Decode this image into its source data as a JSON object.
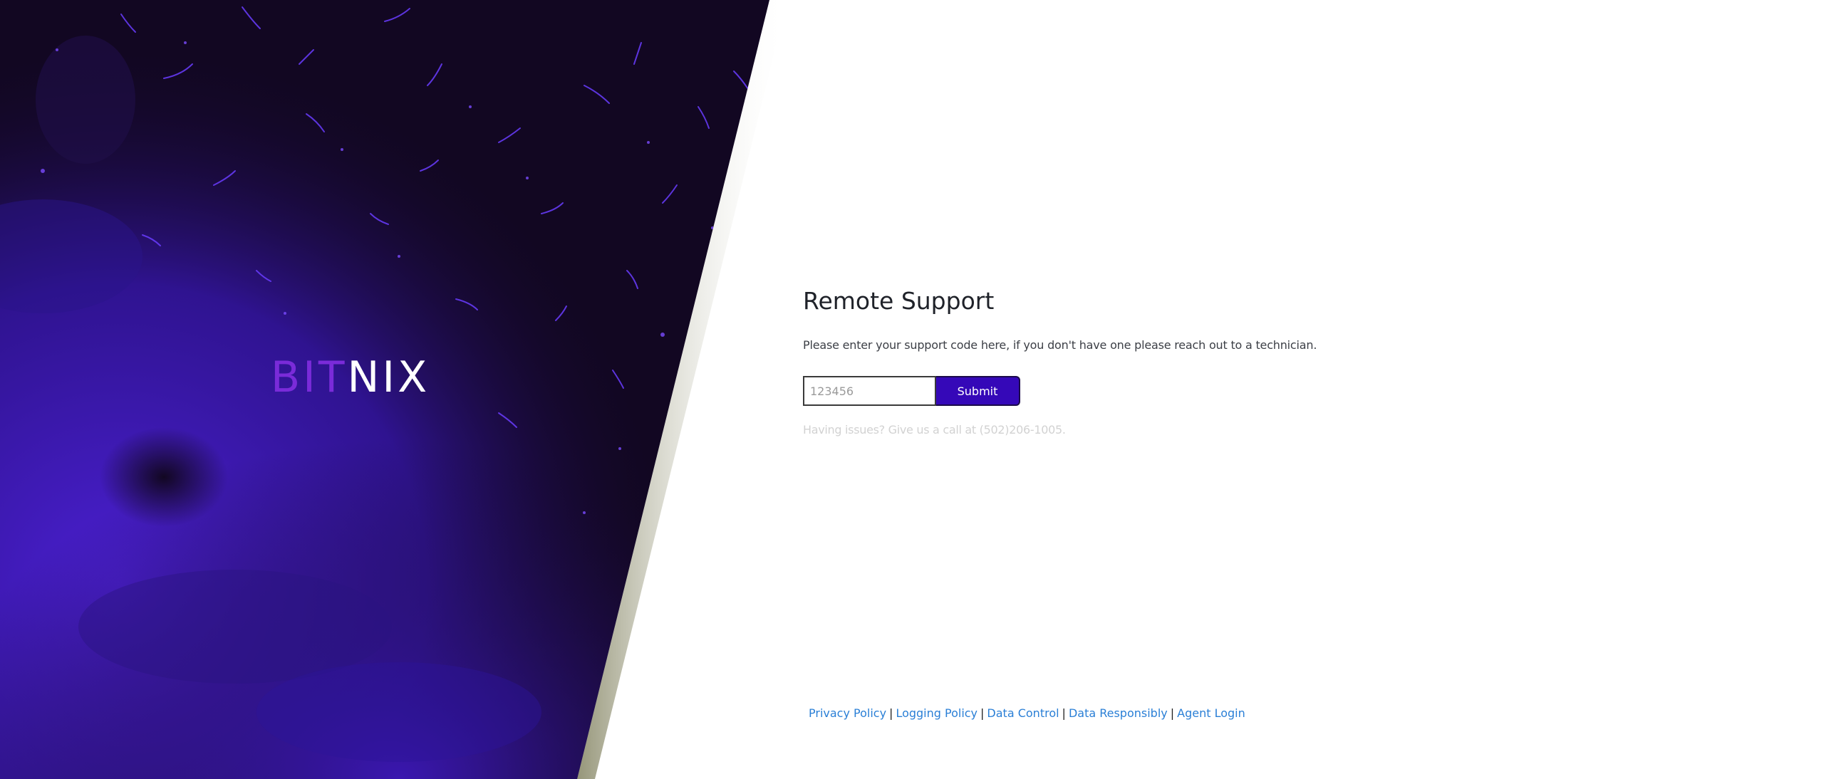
{
  "brand": {
    "part1": "BIT",
    "part2": "NIX"
  },
  "main": {
    "title": "Remote Support",
    "description": "Please enter your support code here, if you don't have one please reach out to a technician.",
    "code_placeholder": "123456",
    "code_value": "",
    "submit_label": "Submit",
    "help_text": "Having issues? Give us a call at (502)206-1005."
  },
  "footer": {
    "links": [
      "Privacy Policy",
      "Logging Policy",
      "Data Control",
      "Data Responsibly",
      "Agent Login"
    ],
    "separator": "|"
  },
  "colors": {
    "accent": "#3508b8",
    "brand_purple": "#7a2bd9",
    "link": "#2a7fd6",
    "hero_dark": "#120722"
  }
}
